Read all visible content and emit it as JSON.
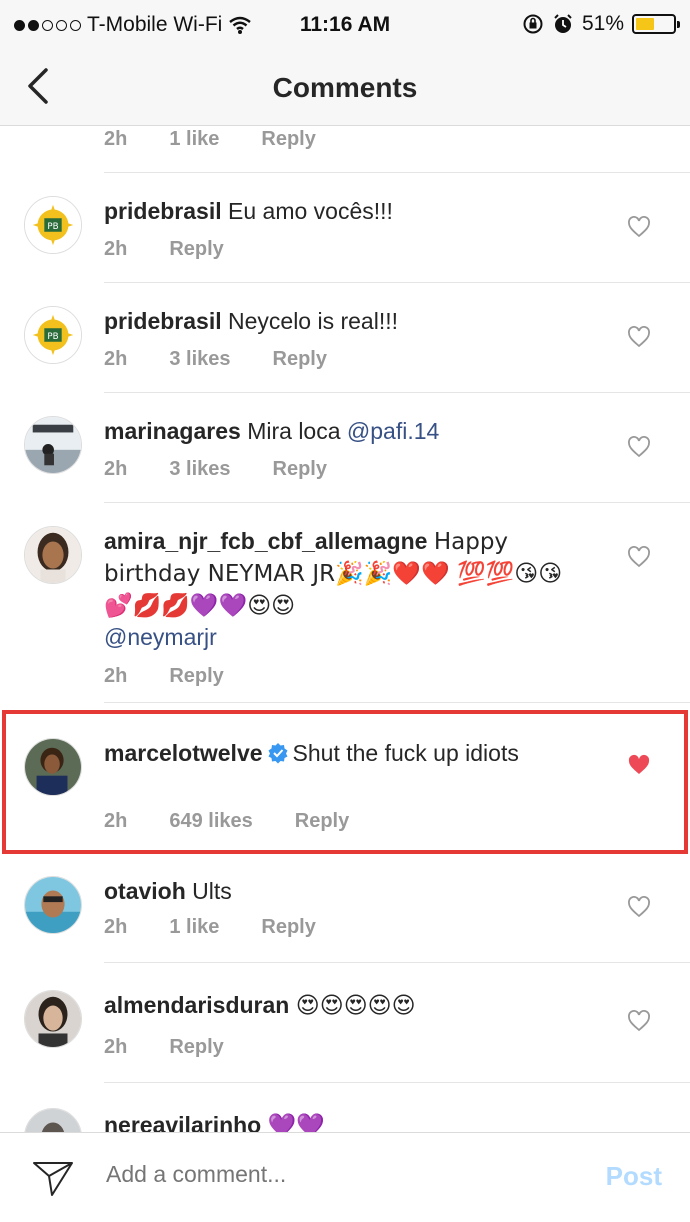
{
  "status_bar": {
    "carrier": "T-Mobile Wi-Fi",
    "time": "11:16 AM",
    "battery_percent": "51%",
    "battery_level": 0.51,
    "signal_bars_filled": 2,
    "signal_bars_total": 5
  },
  "header": {
    "title": "Comments",
    "back_icon": "chevron-left-icon"
  },
  "partial_top": {
    "time": "2h",
    "likes": "1 like",
    "reply": "Reply"
  },
  "comments": [
    {
      "username": "pridebrasil",
      "text": "Eu amo vocês!!!",
      "time": "2h",
      "likes": "",
      "reply": "Reply",
      "liked": false
    },
    {
      "username": "pridebrasil",
      "text": "Neycelo is real!!!",
      "time": "2h",
      "likes": "3 likes",
      "reply": "Reply",
      "liked": false
    },
    {
      "username": "marinagares",
      "text": "Mira loca ",
      "mention": "@pafi.14",
      "time": "2h",
      "likes": "3 likes",
      "reply": "Reply",
      "liked": false
    },
    {
      "username": "amira_njr_fcb_cbf_allemagne",
      "text": "Happy birthday NEYMAR JR🎉🎉❤️❤️ 💯💯😘😘💕💋💋💜💜😍😍",
      "mention": "@neymarjr",
      "time": "2h",
      "likes": "",
      "reply": "Reply",
      "liked": false
    },
    {
      "username": "marcelotwelve",
      "verified": true,
      "text": "Shut the fuck up idiots",
      "time": "2h",
      "likes": "649 likes",
      "reply": "Reply",
      "liked": true,
      "highlighted": true
    },
    {
      "username": "otavioh",
      "text": "Ults",
      "time": "2h",
      "likes": "1 like",
      "reply": "Reply",
      "liked": false
    },
    {
      "username": "almendarisduran",
      "text": "😍😍😍😍😍",
      "time": "2h",
      "likes": "",
      "reply": "Reply",
      "liked": false
    },
    {
      "username": "nereavilarinho",
      "text": "💜💜",
      "time": "",
      "likes": "",
      "reply": "",
      "liked": false
    }
  ],
  "composer": {
    "placeholder": "Add a comment...",
    "post_label": "Post",
    "send_icon": "paper-plane-icon"
  },
  "colors": {
    "highlight_border": "#e53935",
    "liked_heart": "#ed4956",
    "mention": "#385185",
    "post_disabled": "#b3dbff"
  }
}
